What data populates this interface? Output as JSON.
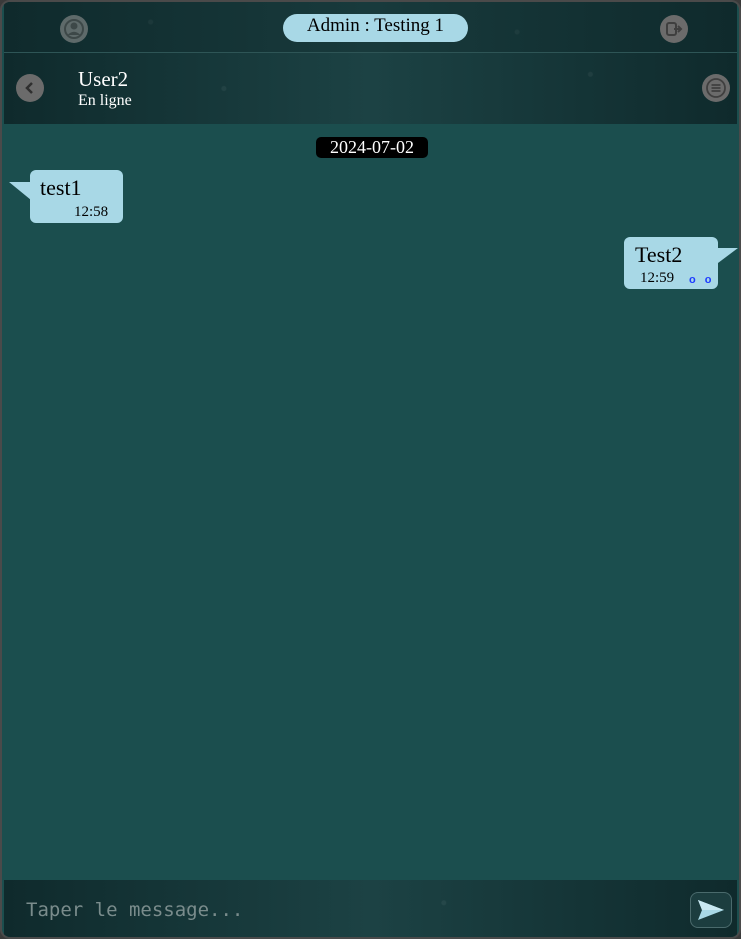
{
  "topbar": {
    "admin_label": "Admin : Testing 1",
    "profile_icon": "user-circle-icon",
    "logout_icon": "logout-icon"
  },
  "header": {
    "back_icon": "chevron-left-icon",
    "contact_name": "User2",
    "contact_status": "En ligne",
    "menu_icon": "menu-lines-icon"
  },
  "chat": {
    "date": "2024-07-02",
    "messages": [
      {
        "direction": "incoming",
        "text": "test1",
        "time": "12:58"
      },
      {
        "direction": "outgoing",
        "text": "Test2",
        "time": "12:59",
        "read_ticks": "o o"
      }
    ]
  },
  "footer": {
    "input_placeholder": "Taper le message...",
    "input_value": "",
    "send_icon": "send-arrow-icon"
  },
  "colors": {
    "chat_background": "#1b4e4e",
    "bubble": "#a8d8e6",
    "pill": "#a8d8e6",
    "read_ticks": "#1e3cff"
  }
}
